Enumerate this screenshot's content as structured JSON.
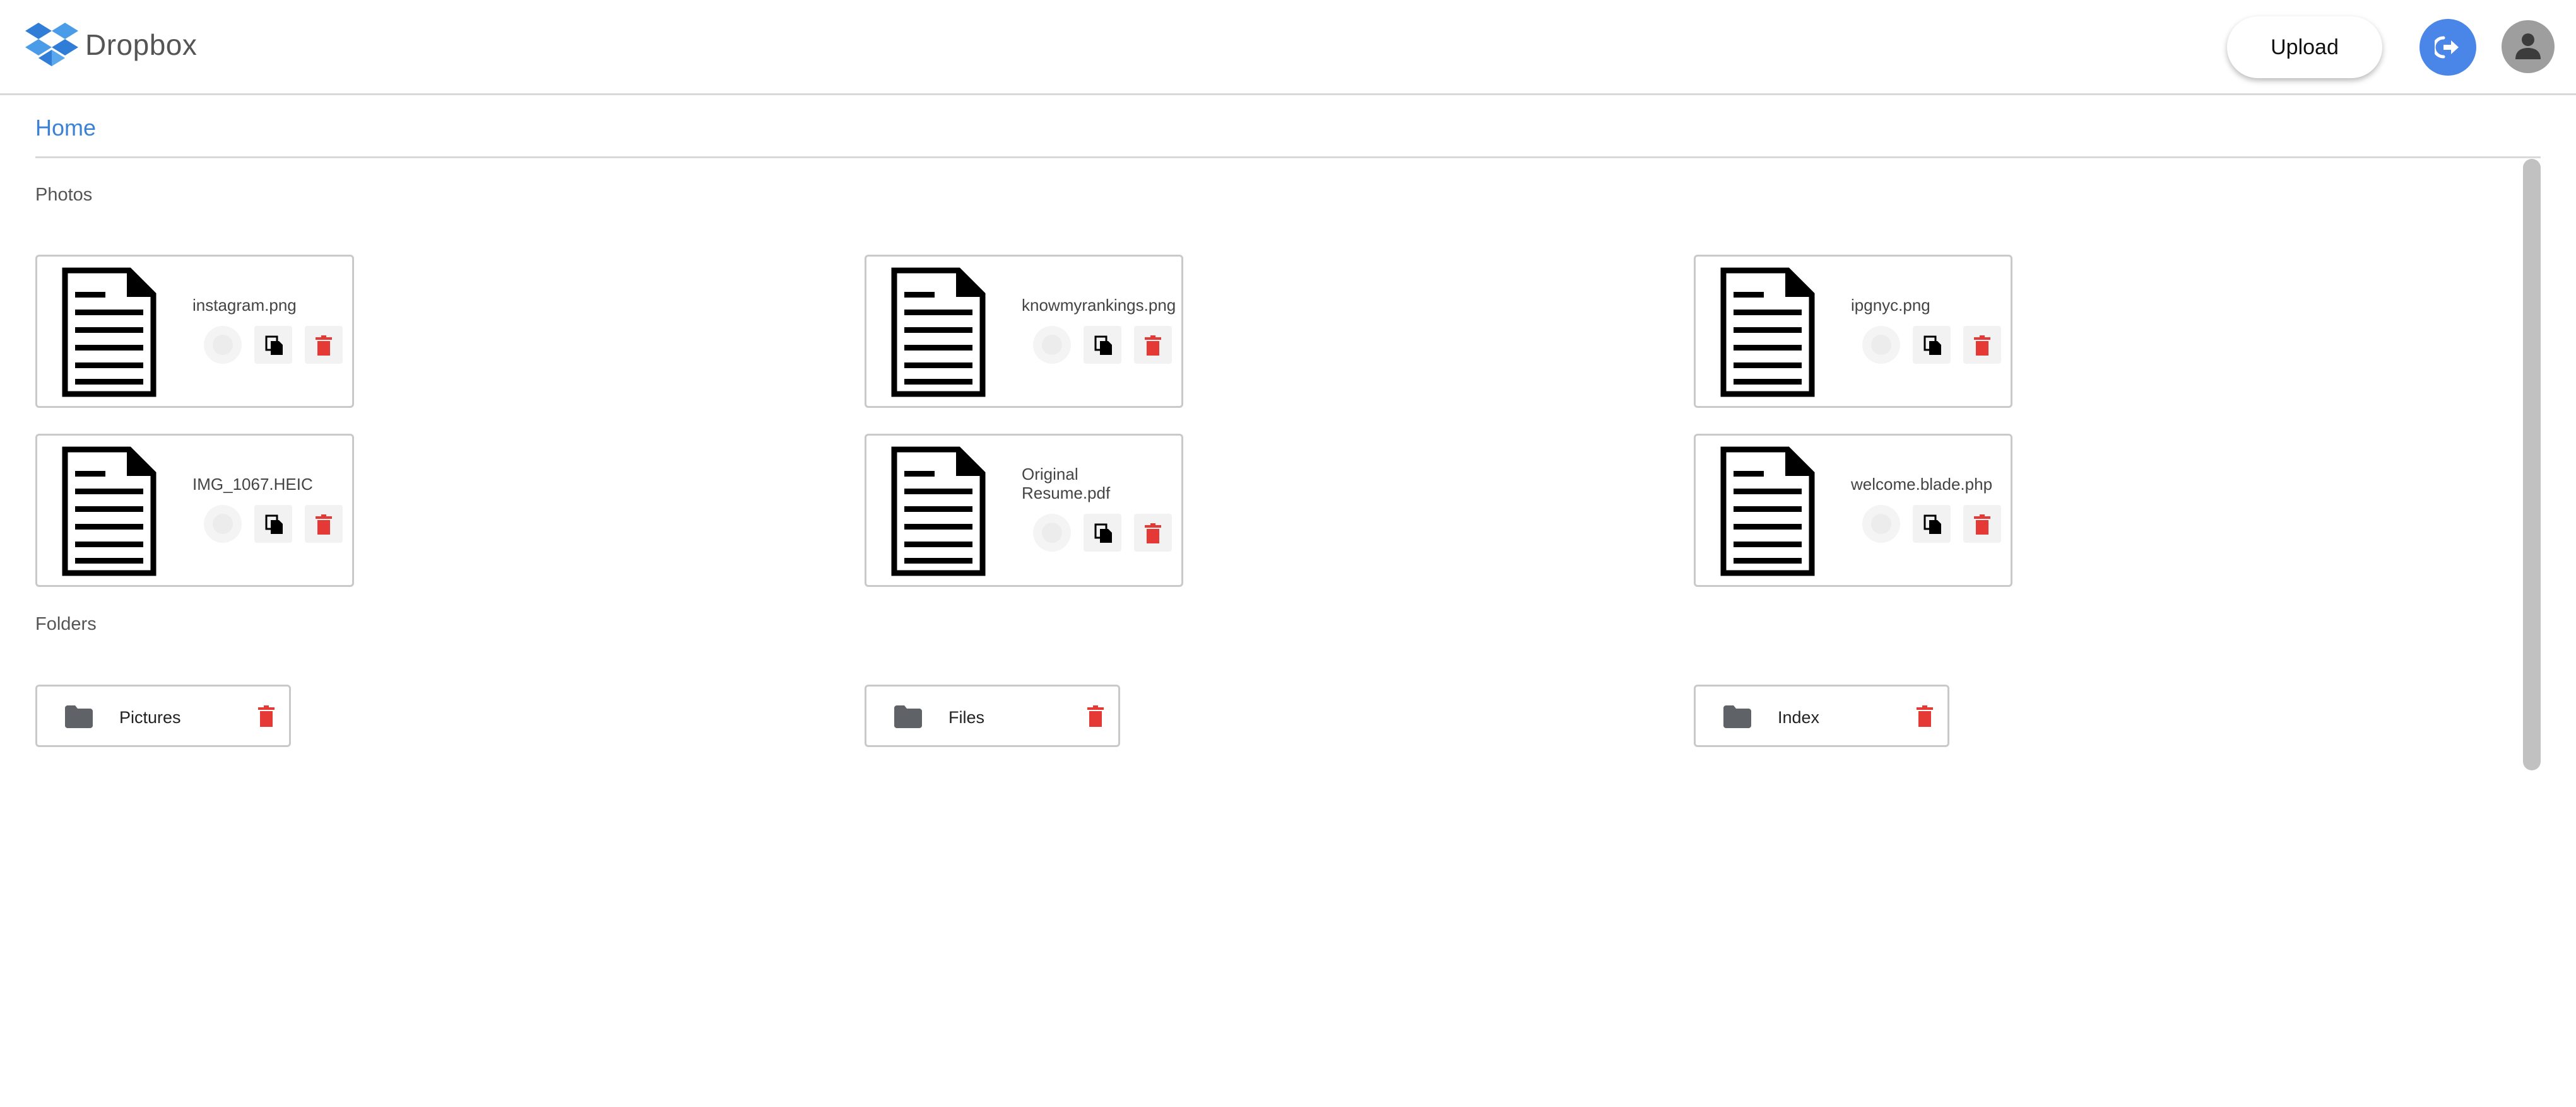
{
  "app": {
    "name": "Dropbox",
    "upload_label": "Upload",
    "accent_color": "#4a86e8",
    "delete_color": "#e53935"
  },
  "breadcrumb": {
    "current": "Home"
  },
  "sections": {
    "photos_title": "Photos",
    "folders_title": "Folders"
  },
  "files": [
    {
      "name": "instagram.png",
      "icon": "document-icon"
    },
    {
      "name": "knowmyrankings.png",
      "icon": "document-icon"
    },
    {
      "name": "ipgnyc.png",
      "icon": "document-icon"
    },
    {
      "name": "IMG_1067.HEIC",
      "icon": "document-icon"
    },
    {
      "name": "Original Resume.pdf",
      "icon": "document-icon"
    },
    {
      "name": "welcome.blade.php",
      "icon": "document-icon"
    }
  ],
  "folders": [
    {
      "name": "Pictures",
      "icon": "folder-icon"
    },
    {
      "name": "Files",
      "icon": "folder-icon"
    },
    {
      "name": "Index",
      "icon": "folder-icon"
    }
  ]
}
